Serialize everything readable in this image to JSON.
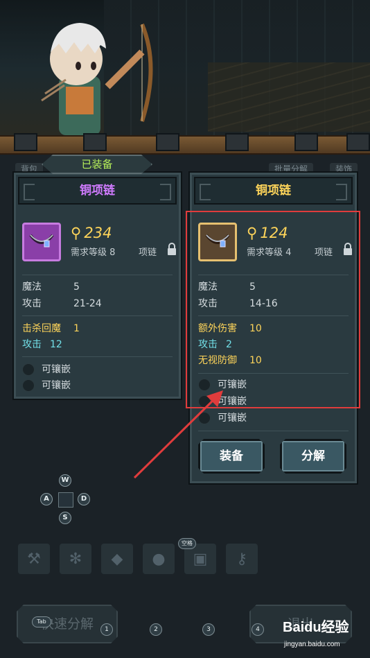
{
  "background": {
    "bg_tabs": [
      "背包",
      "批量分解",
      "装饰"
    ],
    "colors": {
      "panel": "#2a3a40",
      "accent_purple": "#d07bff",
      "accent_gold": "#ffd55a",
      "equipped_green": "#b6f05a",
      "highlight_red": "#e03c3c"
    }
  },
  "equipped_label": "已装备",
  "left_item": {
    "name": "铜项链",
    "rarity": "purple",
    "icon": "necklace-icon",
    "power": "234",
    "requirement": "需求等级 8",
    "slot": "项链",
    "base_stats": [
      {
        "name": "魔法",
        "value": "5"
      },
      {
        "name": "攻击",
        "value": "21-24"
      }
    ],
    "bonus_stats": [
      {
        "name": "击杀回魔",
        "value": "1",
        "color": "yellow"
      },
      {
        "name": "攻击",
        "value": "12",
        "color": "cyan"
      }
    ],
    "sockets": [
      "可镶嵌",
      "可镶嵌"
    ]
  },
  "right_item": {
    "name": "铜项链",
    "rarity": "gold",
    "icon": "necklace-icon",
    "power": "124",
    "requirement": "需求等级 4",
    "slot": "项链",
    "base_stats": [
      {
        "name": "魔法",
        "value": "5"
      },
      {
        "name": "攻击",
        "value": "14-16"
      }
    ],
    "bonus_stats": [
      {
        "name": "额外伤害",
        "value": "10",
        "color": "yellow"
      },
      {
        "name": "攻击",
        "value": "2",
        "color": "cyan"
      },
      {
        "name": "无视防御",
        "value": "10",
        "color": "yellow"
      }
    ],
    "sockets": [
      "可镶嵌",
      "可镶嵌",
      "可镶嵌"
    ],
    "buttons": {
      "equip": "装备",
      "decompose": "分解"
    }
  },
  "dpad": {
    "up": "W",
    "left": "A",
    "right": "D",
    "down": "S"
  },
  "toolbar": {
    "icons": [
      "hammer-icon",
      "paw-icon",
      "gem-icon",
      "gloves-icon",
      "chest-icon",
      "key-icon"
    ],
    "space_hint": "空格"
  },
  "bottom": {
    "quick_decompose": "快速分解",
    "exit": "退出",
    "tab_hint": "Tab",
    "number_hints": [
      "1",
      "2",
      "3",
      "4"
    ]
  },
  "watermark": {
    "brand": "Baidu经验",
    "url": "jingyan.baidu.com"
  }
}
